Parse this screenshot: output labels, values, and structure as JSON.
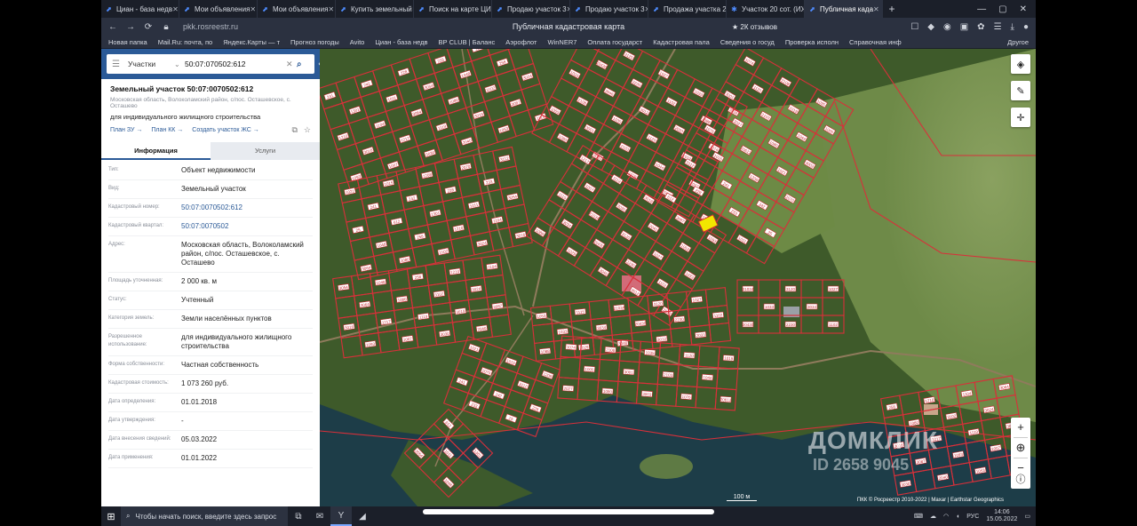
{
  "browser": {
    "tabs": [
      {
        "label": "Циан - база недв",
        "icon": "cian-icon"
      },
      {
        "label": "Мои объявления",
        "icon": "cian-icon"
      },
      {
        "label": "Мои объявления",
        "icon": "cian-icon"
      },
      {
        "label": "Купить земельный",
        "icon": "cian-icon"
      },
      {
        "label": "Поиск на карте ЦИ",
        "icon": "cian-icon"
      },
      {
        "label": "Продаю участок 3",
        "icon": "cian-icon"
      },
      {
        "label": "Продаю участок 3",
        "icon": "cian-icon"
      },
      {
        "label": "Продажа участка 2",
        "icon": "cian-icon"
      },
      {
        "label": "Участок 20 сот. (ИЖ",
        "icon": "colorful-icon"
      },
      {
        "label": "Публичная када",
        "icon": "map-icon",
        "active": true
      }
    ],
    "url": "pkk.rosreestr.ru",
    "page_title": "Публичная кадастровая карта",
    "reviews": "★ 2К отзывов",
    "bookmarks": [
      "Новая папка",
      "Mail.Ru: почта, по",
      "Яндекс.Карты — т",
      "Прогноз погоды",
      "Avito",
      "Циан - база недв",
      "ВР CLUB | Баланс",
      "Аэрофлот",
      "WinNER7",
      "Оплата государст",
      "Кадастровая пала",
      "Сведения о госуд",
      "Проверка исполн",
      "Справочная инф"
    ],
    "bookmarks_more": "Другое"
  },
  "search": {
    "type": "Участки",
    "value": "50:07:070502:612"
  },
  "parcel": {
    "title": "Земельный участок 50:07:0070502:612",
    "address_short": "Московская область, Волоколамский район, с/пос. Осташевское, с. Осташево",
    "use": "для индивидуального жилищного строительства",
    "plan_zu": "План ЗУ →",
    "plan_kk": "План КК →",
    "create_ks": "Создать участок ЖС →"
  },
  "panel_tabs": {
    "info": "Информация",
    "services": "Услуги"
  },
  "info_rows": [
    {
      "k": "Тип:",
      "v": "Объект недвижимости"
    },
    {
      "k": "Вид:",
      "v": "Земельный участок"
    },
    {
      "k": "Кадастровый номер:",
      "v": "50:07:0070502:612",
      "link": true
    },
    {
      "k": "Кадастровый квартал:",
      "v": "50:07:0070502",
      "link": true
    },
    {
      "k": "Адрес:",
      "v": "Московская область, Волоколамский район, с/пос. Осташевское, с. Осташево"
    },
    {
      "k": "Площадь уточненная:",
      "v": "2 000 кв. м"
    },
    {
      "k": "Статус:",
      "v": "Учтенный"
    },
    {
      "k": "Категория земель:",
      "v": "Земли населённых пунктов"
    },
    {
      "k": "Разрешенное использование:",
      "v": "для индивидуального жилищного строительства"
    },
    {
      "k": "Форма собственности:",
      "v": "Частная собственность"
    },
    {
      "k": "Кадастровая стоимость:",
      "v": "1 073 260 руб."
    },
    {
      "k": "Дата определения:",
      "v": "01.01.2018"
    },
    {
      "k": "Дата утверждения:",
      "v": "-"
    },
    {
      "k": "Дата внесения сведений:",
      "v": "05.03.2022"
    },
    {
      "k": "Дата применения:",
      "v": "01.01.2022"
    }
  ],
  "map": {
    "scale": "100 м",
    "copyright": "ПКК © Росреестр 2010-2022 | Maxar | Earthstar Geographics",
    "watermark": "ДОМКЛИК",
    "watermark_id": "ID 2658 9045",
    "parcel_labels": [
      "241",
      "242",
      "228",
      "233",
      "25",
      "612",
      "1301",
      "1011",
      "3054",
      "1048",
      "258",
      "1210",
      "1104",
      "3064",
      "1080",
      "3102",
      "3024",
      "3016",
      "1217",
      "1119",
      "3019",
      "3087",
      "1093",
      "1007",
      "3030",
      "2040",
      "1053",
      "1115",
      "21034",
      "3120",
      "1027",
      "1033",
      "3034",
      "20430",
      "2230",
      "1102",
      "1088",
      "1029",
      "3046",
      "3012",
      "2033",
      "1074",
      "2108",
      "1035",
      "1120",
      "1019",
      "1005",
      "3001",
      "2103",
      "1044",
      "2027",
      "1080",
      "3003",
      "1076",
      "20612",
      "1021",
      "1015",
      "1208",
      "2070",
      "3112"
    ],
    "highlight_color": "#f2e600"
  },
  "taskbar": {
    "search_placeholder": "Чтобы начать поиск, введите здесь запрос",
    "lang": "РУС",
    "time": "14:06",
    "date": "15.05.2022"
  }
}
